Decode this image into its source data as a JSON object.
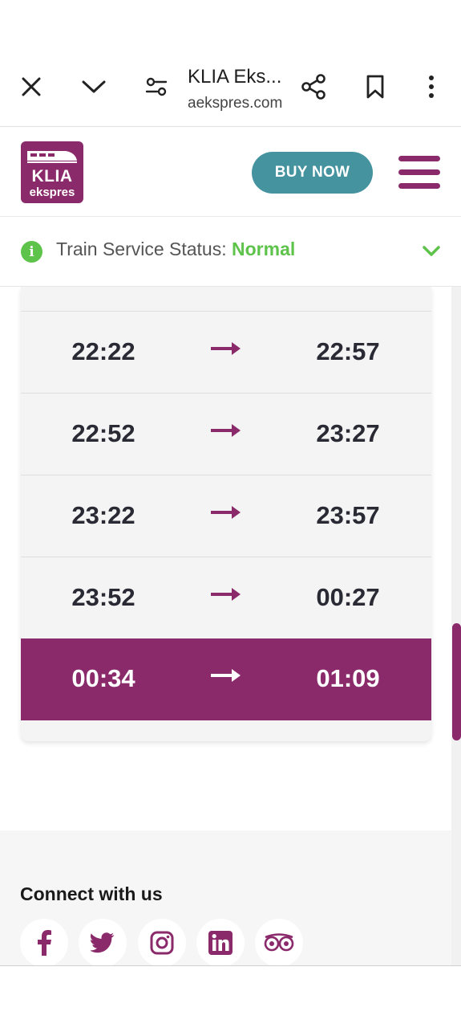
{
  "browser": {
    "title": "KLIA Eks...",
    "url": "aekspres.com"
  },
  "header": {
    "logo_text_top": "KLIA",
    "logo_text_bottom": "ekspres",
    "buy_now_label": "BUY NOW"
  },
  "status": {
    "label": "Train Service Status: ",
    "value": "Normal",
    "value_color": "#5ec34b"
  },
  "schedule": {
    "rows": [
      {
        "departure": "22:22",
        "arrival": "22:57",
        "active": false
      },
      {
        "departure": "22:52",
        "arrival": "23:27",
        "active": false
      },
      {
        "departure": "23:22",
        "arrival": "23:57",
        "active": false
      },
      {
        "departure": "23:52",
        "arrival": "00:27",
        "active": false
      },
      {
        "departure": "00:34",
        "arrival": "01:09",
        "active": true
      }
    ]
  },
  "footer": {
    "connect_title": "Connect with us",
    "social_icons": [
      "facebook-icon",
      "twitter-icon",
      "instagram-icon",
      "linkedin-icon",
      "tripadvisor-icon"
    ]
  },
  "colors": {
    "brand_purple": "#8b2a6b",
    "buy_teal": "#44939f",
    "status_green": "#5ec34b"
  }
}
